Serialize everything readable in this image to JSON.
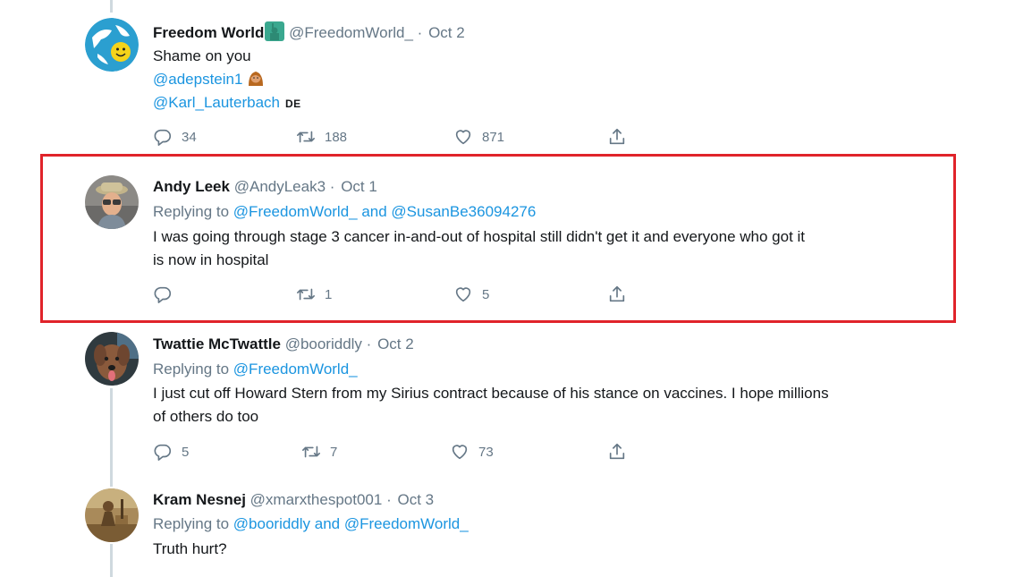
{
  "tweets": [
    {
      "name": "Freedom World",
      "handle": "@FreedomWorld_",
      "dot": "·",
      "date": "Oct 2",
      "line1": "Shame on you",
      "mention1": "@adepstein1",
      "mention2": "@Karl_Lauterbach",
      "flag_label": "DE",
      "replies": "34",
      "retweets": "188",
      "likes": "871"
    },
    {
      "name": "Andy Leek",
      "handle": "@AndyLeak3",
      "dot": "·",
      "date": "Oct 1",
      "replying_prefix": "Replying to",
      "replying_mentions": "@FreedomWorld_ and @SusanBe36094276",
      "line1": "I was going through stage 3 cancer in-and-out of hospital still didn't get it and everyone who got it",
      "line2": "is now in hospital",
      "replies": "",
      "retweets": "1",
      "likes": "5"
    },
    {
      "name": "Twattie McTwattle",
      "handle": "@booriddly",
      "dot": "·",
      "date": "Oct 2",
      "replying_prefix": "Replying to",
      "replying_mentions": "@FreedomWorld_",
      "line1": "I just cut off Howard Stern from my Sirius contract because of his stance on vaccines. I hope millions",
      "line2": "of others do too",
      "replies": "5",
      "retweets": "7",
      "likes": "73"
    },
    {
      "name": "Kram Nesnej",
      "handle": "@xmarxthespot001",
      "dot": "·",
      "date": "Oct 3",
      "replying_prefix": "Replying to",
      "replying_mentions": "@booriddly and @FreedomWorld_",
      "line1": "Truth hurt?"
    }
  ],
  "icons": {
    "reply": "reply-icon",
    "retweet": "retweet-icon",
    "like": "heart-icon",
    "share": "share-icon"
  },
  "colors": {
    "mention": "#1b95e0",
    "secondary": "#657786",
    "highlight_border": "#e0232a",
    "thread_line": "#cfd9de"
  }
}
